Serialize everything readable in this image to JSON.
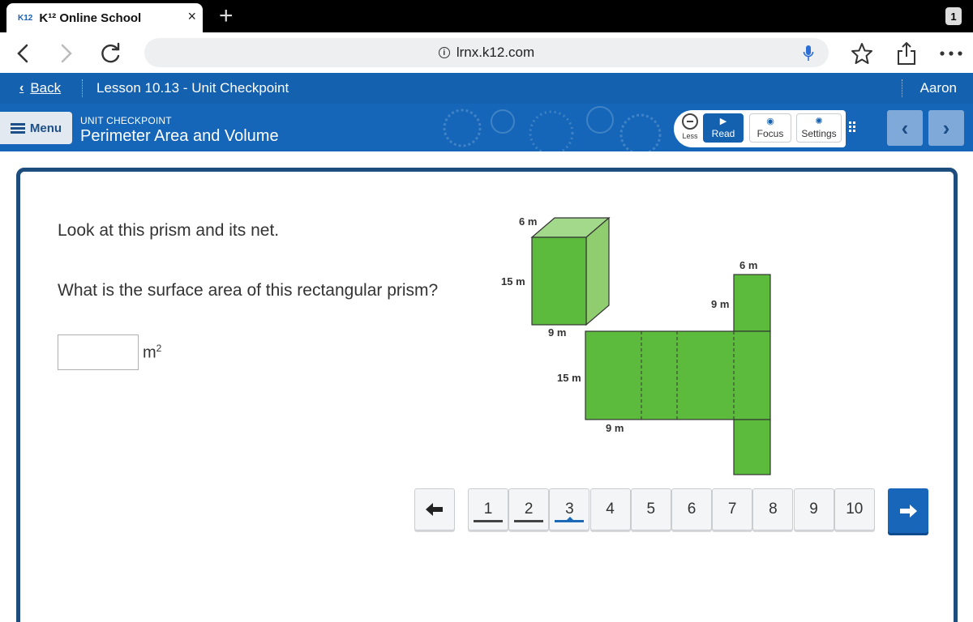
{
  "browser": {
    "tab_favicon": "K12",
    "tab_title": "K¹² Online School",
    "tab_close": "×",
    "new_tab": "+",
    "tab_count": "1",
    "url": "lrnx.k12.com",
    "url_info_glyph": "i"
  },
  "header": {
    "back_label": "Back",
    "back_chevron": "‹",
    "lesson_title": "Lesson 10.13 - Unit Checkpoint",
    "user_name": "Aaron"
  },
  "subheader": {
    "menu_label": "Menu",
    "kicker": "UNIT CHECKPOINT",
    "title": "Perimeter Area and Volume",
    "less_label": "Less",
    "read_label": "Read",
    "read_icon": "▶",
    "focus_label": "Focus",
    "focus_icon": "◉",
    "settings_label": "Settings",
    "settings_icon": "✺",
    "prev_glyph": "‹",
    "next_glyph": "›"
  },
  "question": {
    "line1": "Look at this prism and its net.",
    "line2": "What is the surface area of this rectangular prism?",
    "answer_value": "",
    "unit": "m",
    "unit_power": "2"
  },
  "figure": {
    "prism_top": "6 m",
    "prism_side": "15 m",
    "prism_bottom": "9 m",
    "net_top_width": "6 m",
    "net_side_depth": "9 m",
    "net_height": "15 m",
    "net_bottom_width": "9 m",
    "fill_front": "#5cbb3d",
    "fill_top": "#a3d98a",
    "fill_side": "#8fcd6f"
  },
  "pager": {
    "prev_glyph": "🡐",
    "next_glyph": "🡒",
    "pages": [
      "1",
      "2",
      "3",
      "4",
      "5",
      "6",
      "7",
      "8",
      "9",
      "10"
    ],
    "answered": [
      1,
      2
    ],
    "current": 3
  },
  "colors": {
    "header_blue": "#1461b0",
    "card_border": "#1d4d7c",
    "accent": "#1766ba"
  }
}
